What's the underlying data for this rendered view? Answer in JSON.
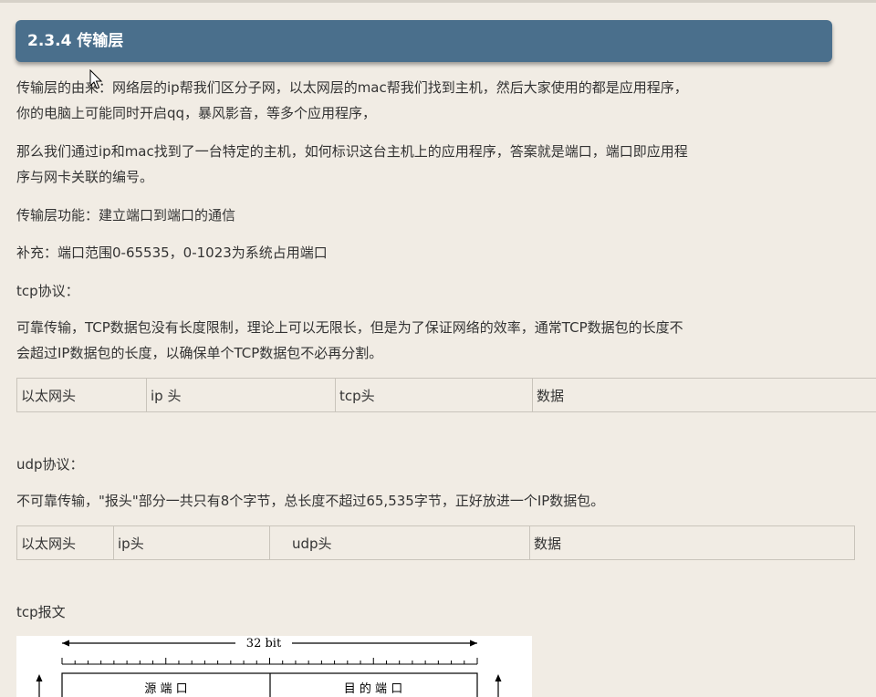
{
  "section": {
    "title": "2.3.4 传输层"
  },
  "paragraphs": {
    "p1_line1": "传输层的由来：网络层的ip帮我们区分子网，以太网层的mac帮我们找到主机，然后大家使用的都是应用程序，",
    "p1_line2": "你的电脑上可能同时开启qq，暴风影音，等多个应用程序，",
    "p2_line1": "那么我们通过ip和mac找到了一台特定的主机，如何标识这台主机上的应用程序，答案就是端口，端口即应用程",
    "p2_line2": "序与网卡关联的编号。",
    "p3": "传输层功能：建立端口到端口的通信",
    "p4": "补充：端口范围0-65535，0-1023为系统占用端口",
    "tcp_heading": "tcp协议：",
    "tcp_line1": "可靠传输，TCP数据包没有长度限制，理论上可以无限长，但是为了保证网络的效率，通常TCP数据包的长度不",
    "tcp_line2": "会超过IP数据包的长度，以确保单个TCP数据包不必再分割。",
    "udp_heading": "udp协议：",
    "udp_line": "不可靠传输，\"报头\"部分一共只有8个字节，总长度不超过65,535字节，正好放进一个IP数据包。",
    "tcp_packet_heading": "tcp报文"
  },
  "tcp_table": {
    "cells": [
      "以太网头",
      "ip 头",
      "tcp头",
      "数据"
    ]
  },
  "udp_table": {
    "cells": [
      "以太网头",
      "ip头",
      "udp头",
      "数据"
    ]
  },
  "diagram": {
    "width_label": "32 bit",
    "fields": [
      "源 端 口",
      "目 的 端 口"
    ]
  }
}
